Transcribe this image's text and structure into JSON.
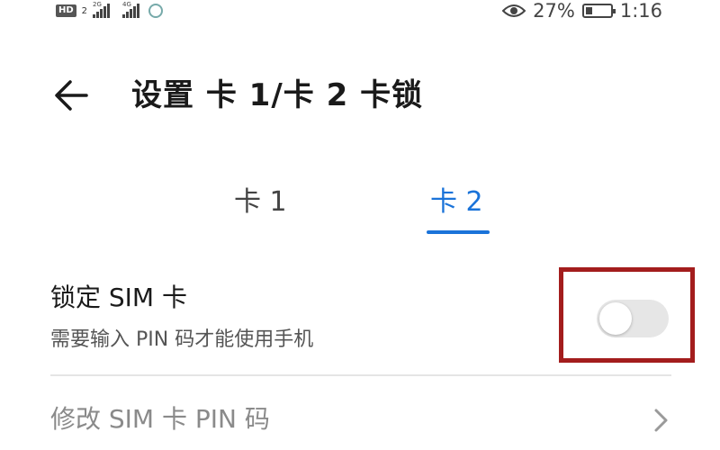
{
  "status_bar": {
    "hd_badge": "HD",
    "hd_sim": "2",
    "sig1_tag": "2G",
    "sig2_tag": "4G",
    "battery_percent": "27%",
    "battery_level": 0.27,
    "time": "1:16"
  },
  "header": {
    "title": "设置 卡 1/卡 2 卡锁"
  },
  "tabs": [
    {
      "label": "卡 1",
      "selected": false
    },
    {
      "label": "卡 2",
      "selected": true
    }
  ],
  "settings": {
    "lock_sim": {
      "title": "锁定 SIM 卡",
      "subtitle": "需要输入 PIN 码才能使用手机",
      "enabled": false
    },
    "change_pin": {
      "label": "修改 SIM 卡 PIN 码"
    }
  },
  "colors": {
    "accent": "#1a73d9",
    "highlight_box": "#a31d1d",
    "toggle_off": "#e6e6e6"
  },
  "icons": {
    "back": "arrow-left-icon",
    "chevron": "chevron-right-icon",
    "eye": "eye-icon"
  }
}
